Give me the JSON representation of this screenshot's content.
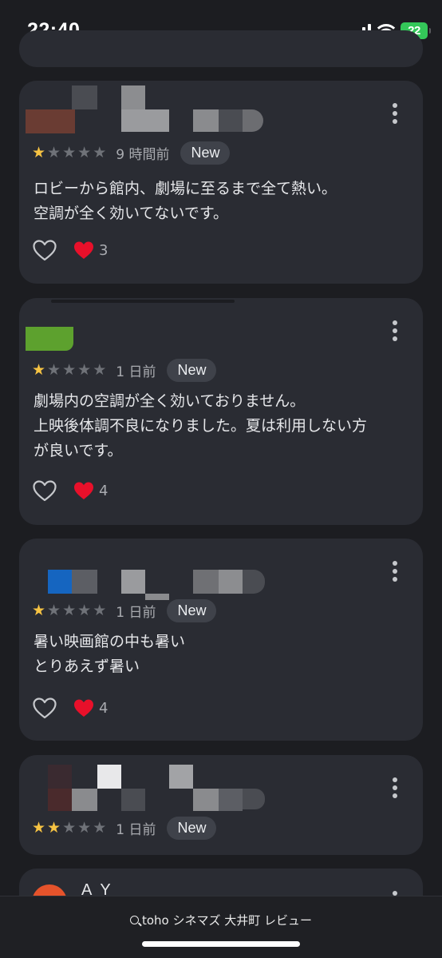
{
  "status_bar": {
    "time": "22:40",
    "battery": "22",
    "icons": [
      "signal-icon",
      "wifi-icon",
      "battery-icon"
    ]
  },
  "reviews": [
    {
      "rating": 1,
      "when": "9 時間前",
      "badge": "New",
      "text": "ロビーから館内、劇場に至るまで全て熱い。\n空調が全く効いてないです。",
      "reaction_count": "3"
    },
    {
      "rating": 1,
      "when": "1 日前",
      "badge": "New",
      "text": "劇場内の空調が全く効いておりません。\n上映後体調不良になりました。夏は利用しない方\nが良いです。",
      "reaction_count": "4"
    },
    {
      "rating": 1,
      "when": "1 日前",
      "badge": "New",
      "text": "暑い映画館の中も暑い\nとりあえず暑い",
      "reaction_count": "4"
    },
    {
      "rating": 2,
      "when": "1 日前",
      "badge": "New"
    }
  ],
  "next_review": {
    "name": "A Y"
  },
  "search_bar": {
    "query": "toho シネマズ 大井町 レビュー"
  },
  "colors": {
    "star_filled": "#f6c343",
    "star_empty": "#6f7278",
    "card_bg": "#2a2c33",
    "heart_red": "#e8102a"
  }
}
